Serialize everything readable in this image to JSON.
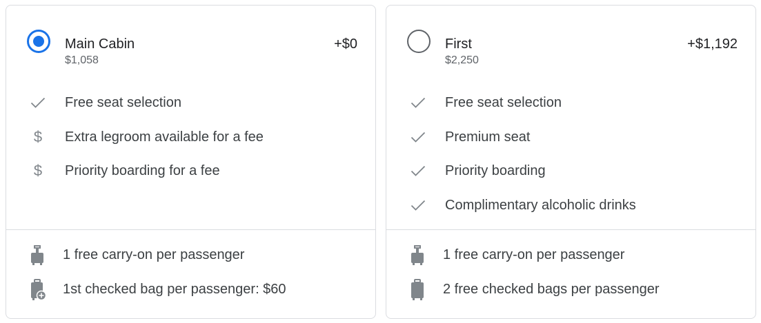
{
  "fares": [
    {
      "name": "Main Cabin",
      "price": "$1,058",
      "difference": "+$0",
      "selected": true,
      "features": [
        {
          "icon": "check-icon",
          "text": "Free seat selection"
        },
        {
          "icon": "dollar-icon",
          "text": "Extra legroom available for a fee"
        },
        {
          "icon": "dollar-icon",
          "text": "Priority boarding for a fee"
        }
      ],
      "bags": [
        {
          "icon": "carry-on-bag-icon",
          "text": "1 free carry-on per passenger"
        },
        {
          "icon": "checked-bag-fee-icon",
          "text": "1st checked bag per passenger: $60"
        }
      ]
    },
    {
      "name": "First",
      "price": "$2,250",
      "difference": "+$1,192",
      "selected": false,
      "features": [
        {
          "icon": "check-icon",
          "text": "Free seat selection"
        },
        {
          "icon": "check-icon",
          "text": "Premium seat"
        },
        {
          "icon": "check-icon",
          "text": "Priority boarding"
        },
        {
          "icon": "check-icon",
          "text": "Complimentary alcoholic drinks"
        }
      ],
      "bags": [
        {
          "icon": "carry-on-bag-icon",
          "text": "1 free carry-on per passenger"
        },
        {
          "icon": "checked-bag-icon",
          "text": "2 free checked bags per passenger"
        }
      ]
    }
  ],
  "colors": {
    "accent": "#1a73e8",
    "border": "#dadce0",
    "icon": "#80868b",
    "text": "#3c4043",
    "title": "#202124"
  }
}
